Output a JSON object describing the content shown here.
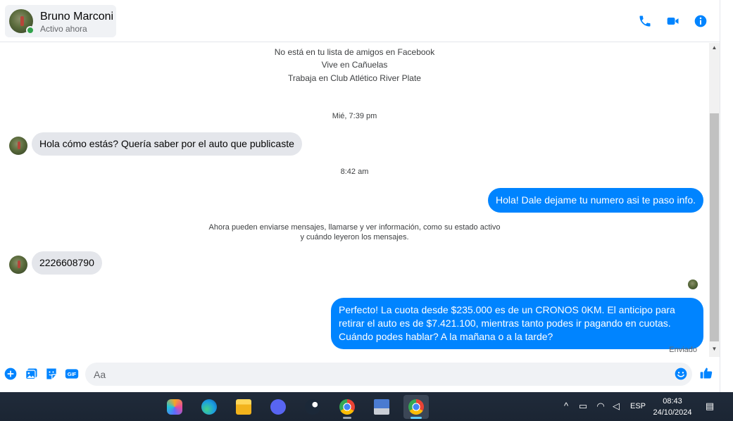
{
  "header": {
    "contact_name": "Bruno Marconi",
    "contact_status": "Activo ahora",
    "icons": [
      "phone-icon",
      "video-camera-icon",
      "info-icon"
    ]
  },
  "profile_info": [
    "No está en tu lista de amigos en Facebook",
    "Vive en Cañuelas",
    "Trabaja en Club Atlético River Plate"
  ],
  "messages": {
    "timestamp_1": "Mié, 7:39 pm",
    "msg_1": "Hola cómo estás? Quería saber por el auto que publicaste",
    "timestamp_2": "8:42 am",
    "msg_2": "Hola! Dale dejame tu numero  asi te paso info.",
    "notice_line_1": "Ahora pueden enviarse mensajes, llamarse y ver información, como su estado activo",
    "notice_line_2": "y cuándo leyeron los mensajes.",
    "msg_3": "2226608790",
    "msg_4": "Perfecto! La cuota desde $235.000 es de un CRONOS 0KM. El anticipo para retirar el auto es de $7.421.100, mientras tanto podes ir pagando en cuotas. Cuándo podes hablar? A la mañana o a la tarde?",
    "sent_label": "Enviado"
  },
  "composer": {
    "placeholder": "Aa",
    "icons": [
      "plus-icon",
      "photo-icon",
      "sticker-icon",
      "gif-icon",
      "emoji-icon",
      "thumbs-up-icon"
    ],
    "gif_label": "GIF"
  },
  "taskbar": {
    "apps": [
      "copilot-icon",
      "edge-icon",
      "file-explorer-icon",
      "discord-icon",
      "steam-icon",
      "chrome-icon",
      "network-app-icon",
      "chrome-profile-icon"
    ],
    "language": "ESP",
    "time": "08:43",
    "date": "24/10/2024"
  },
  "colors": {
    "accent": "#0084ff",
    "bubble_in": "#e4e6eb",
    "online": "#31a24c",
    "taskbar": "#202b3a"
  }
}
